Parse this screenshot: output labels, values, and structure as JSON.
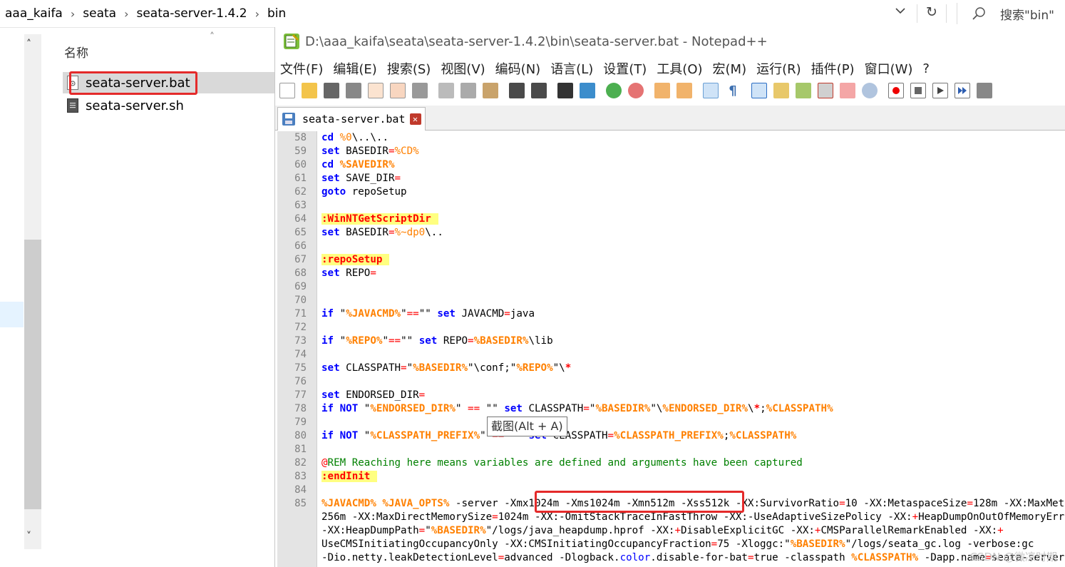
{
  "explorer": {
    "breadcrumbs": [
      "aaa_kaifa",
      "seata",
      "seata-server-1.4.2",
      "bin"
    ],
    "breadcrumb_separator": "›",
    "dropdown_icon": "chevron-down-icon",
    "refresh_glyph": "↻",
    "search_placeholder": "搜索\"bin\"",
    "column_header": "名称",
    "scroll_up_glyph": "˄",
    "scroll_down_glyph": "˅",
    "sort_glyph": "˄",
    "files": [
      {
        "name": "seata-server.bat",
        "icon": "bat-file-icon"
      },
      {
        "name": "seata-server.sh",
        "icon": "sh-file-icon"
      }
    ]
  },
  "notepad": {
    "title": "D:\\aaa_kaifa\\seata\\seata-server-1.4.2\\bin\\seata-server.bat - Notepad++",
    "menu": [
      "文件(F)",
      "编辑(E)",
      "搜索(S)",
      "视图(V)",
      "编码(N)",
      "语言(L)",
      "设置(T)",
      "工具(O)",
      "宏(M)",
      "运行(R)",
      "插件(P)",
      "窗口(W)",
      "?"
    ],
    "tab_label": "seata-server.bat",
    "tab_close_glyph": "✕",
    "tooltip": "截图(Alt + A)",
    "watermark": "CSDN @微凉时期",
    "line_numbers": [
      "58",
      "59",
      "60",
      "61",
      "62",
      "63",
      "64",
      "65",
      "66",
      "67",
      "68",
      "69",
      "70",
      "71",
      "72",
      "73",
      "74",
      "75",
      "76",
      "77",
      "78",
      "79",
      "80",
      "81",
      "82",
      "83",
      "84",
      "85"
    ]
  },
  "colors": {
    "highlight_red": "#e42a2a",
    "keyword_blue": "#0000ff",
    "variable_orange": "#ff8000",
    "label_bg": "#ffff80",
    "comment_green": "#008000"
  }
}
